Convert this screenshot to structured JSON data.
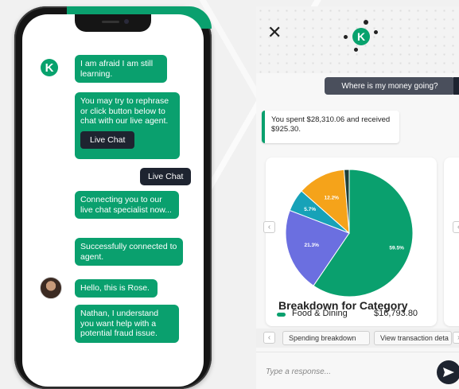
{
  "left_phone": {
    "messages": [
      {
        "from": "bot",
        "text": "I am afraid I am still learning."
      },
      {
        "from": "bot",
        "text": "You may try to rephrase or click button below to chat with our live agent.",
        "button_label": "Live Chat"
      },
      {
        "from": "user",
        "text": "Live Chat"
      },
      {
        "from": "bot",
        "text": "Connecting you to our live chat specialist now..."
      },
      {
        "from": "bot",
        "text": "Successfully connected to agent."
      },
      {
        "from": "agent",
        "text": "Hello, this is Rose."
      },
      {
        "from": "agent",
        "text": "Nathan, I understand you want help with a potential fraud issue."
      }
    ],
    "bot_avatar_letter": "K"
  },
  "right_phone": {
    "header": {
      "close_icon": "close-icon",
      "logo_letter": "K"
    },
    "user_query": "Where is my money going?",
    "summary": "You spent $28,310.06 and received $925.30.",
    "chart_card": {
      "title": "Breakdown for Category",
      "legend_label": "Food & Dining",
      "legend_value": "$16,793.80"
    },
    "quick_replies": [
      "Spending breakdown",
      "View transaction deta"
    ],
    "input_placeholder": "Type a response..."
  },
  "colors": {
    "brand_green": "#0aa06e",
    "dark": "#1e2430",
    "slice_purple": "#6b6fe0",
    "slice_teal": "#17a2b8",
    "slice_orange": "#f5a31a"
  },
  "chart_data": {
    "type": "pie",
    "title": "Breakdown for Category",
    "slices": [
      {
        "label": "59.5%",
        "value": 59.5,
        "color": "#0aa06e"
      },
      {
        "label": "21.3%",
        "value": 21.3,
        "color": "#6b6fe0"
      },
      {
        "label": "5.7%",
        "value": 5.7,
        "color": "#17a2b8"
      },
      {
        "label": "12.2%",
        "value": 12.2,
        "color": "#f5a31a"
      },
      {
        "label": "",
        "value": 1.3,
        "color": "#1e4038"
      }
    ]
  }
}
